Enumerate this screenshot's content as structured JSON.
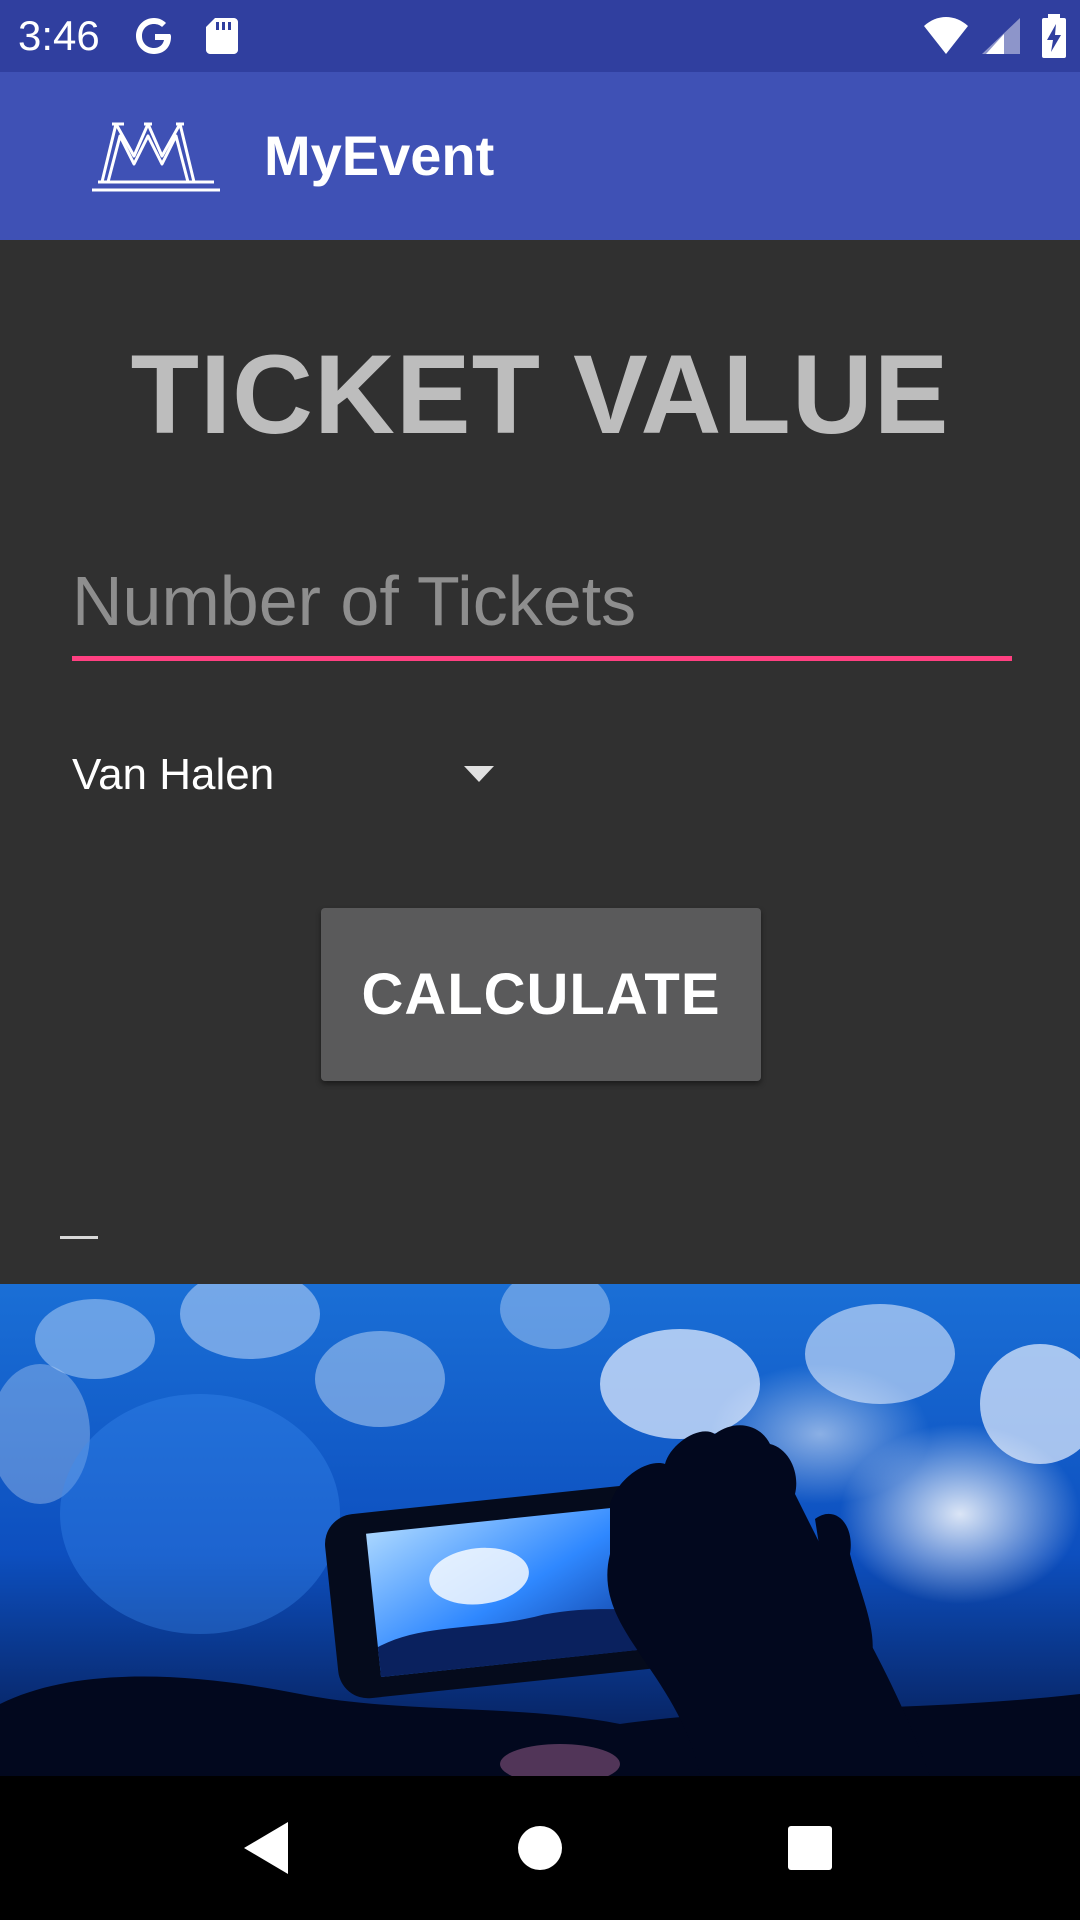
{
  "status_bar": {
    "time": "3:46",
    "icons": [
      "google-icon",
      "sd-card-icon",
      "wifi-icon",
      "cell-signal-icon",
      "battery-charging-icon"
    ]
  },
  "app_bar": {
    "title": "MyEvent",
    "logo_icon": "myevent-logo-icon"
  },
  "main": {
    "heading": "TICKET VALUE",
    "tickets_input": {
      "placeholder": "Number of Tickets",
      "value": ""
    },
    "band_spinner": {
      "selected": "Van Halen"
    },
    "calculate_label": "CALCULATE",
    "result": ""
  },
  "photo": {
    "icon": "concert-photo-image"
  },
  "nav_bar": {
    "icons": [
      "back-icon",
      "home-icon",
      "recents-icon"
    ]
  },
  "colors": {
    "status_bar": "#303f9f",
    "app_bar": "#3f51b5",
    "background": "#303030",
    "accent": "#ff4081",
    "heading": "#bdbdbd",
    "button": "#5a5a5b"
  }
}
